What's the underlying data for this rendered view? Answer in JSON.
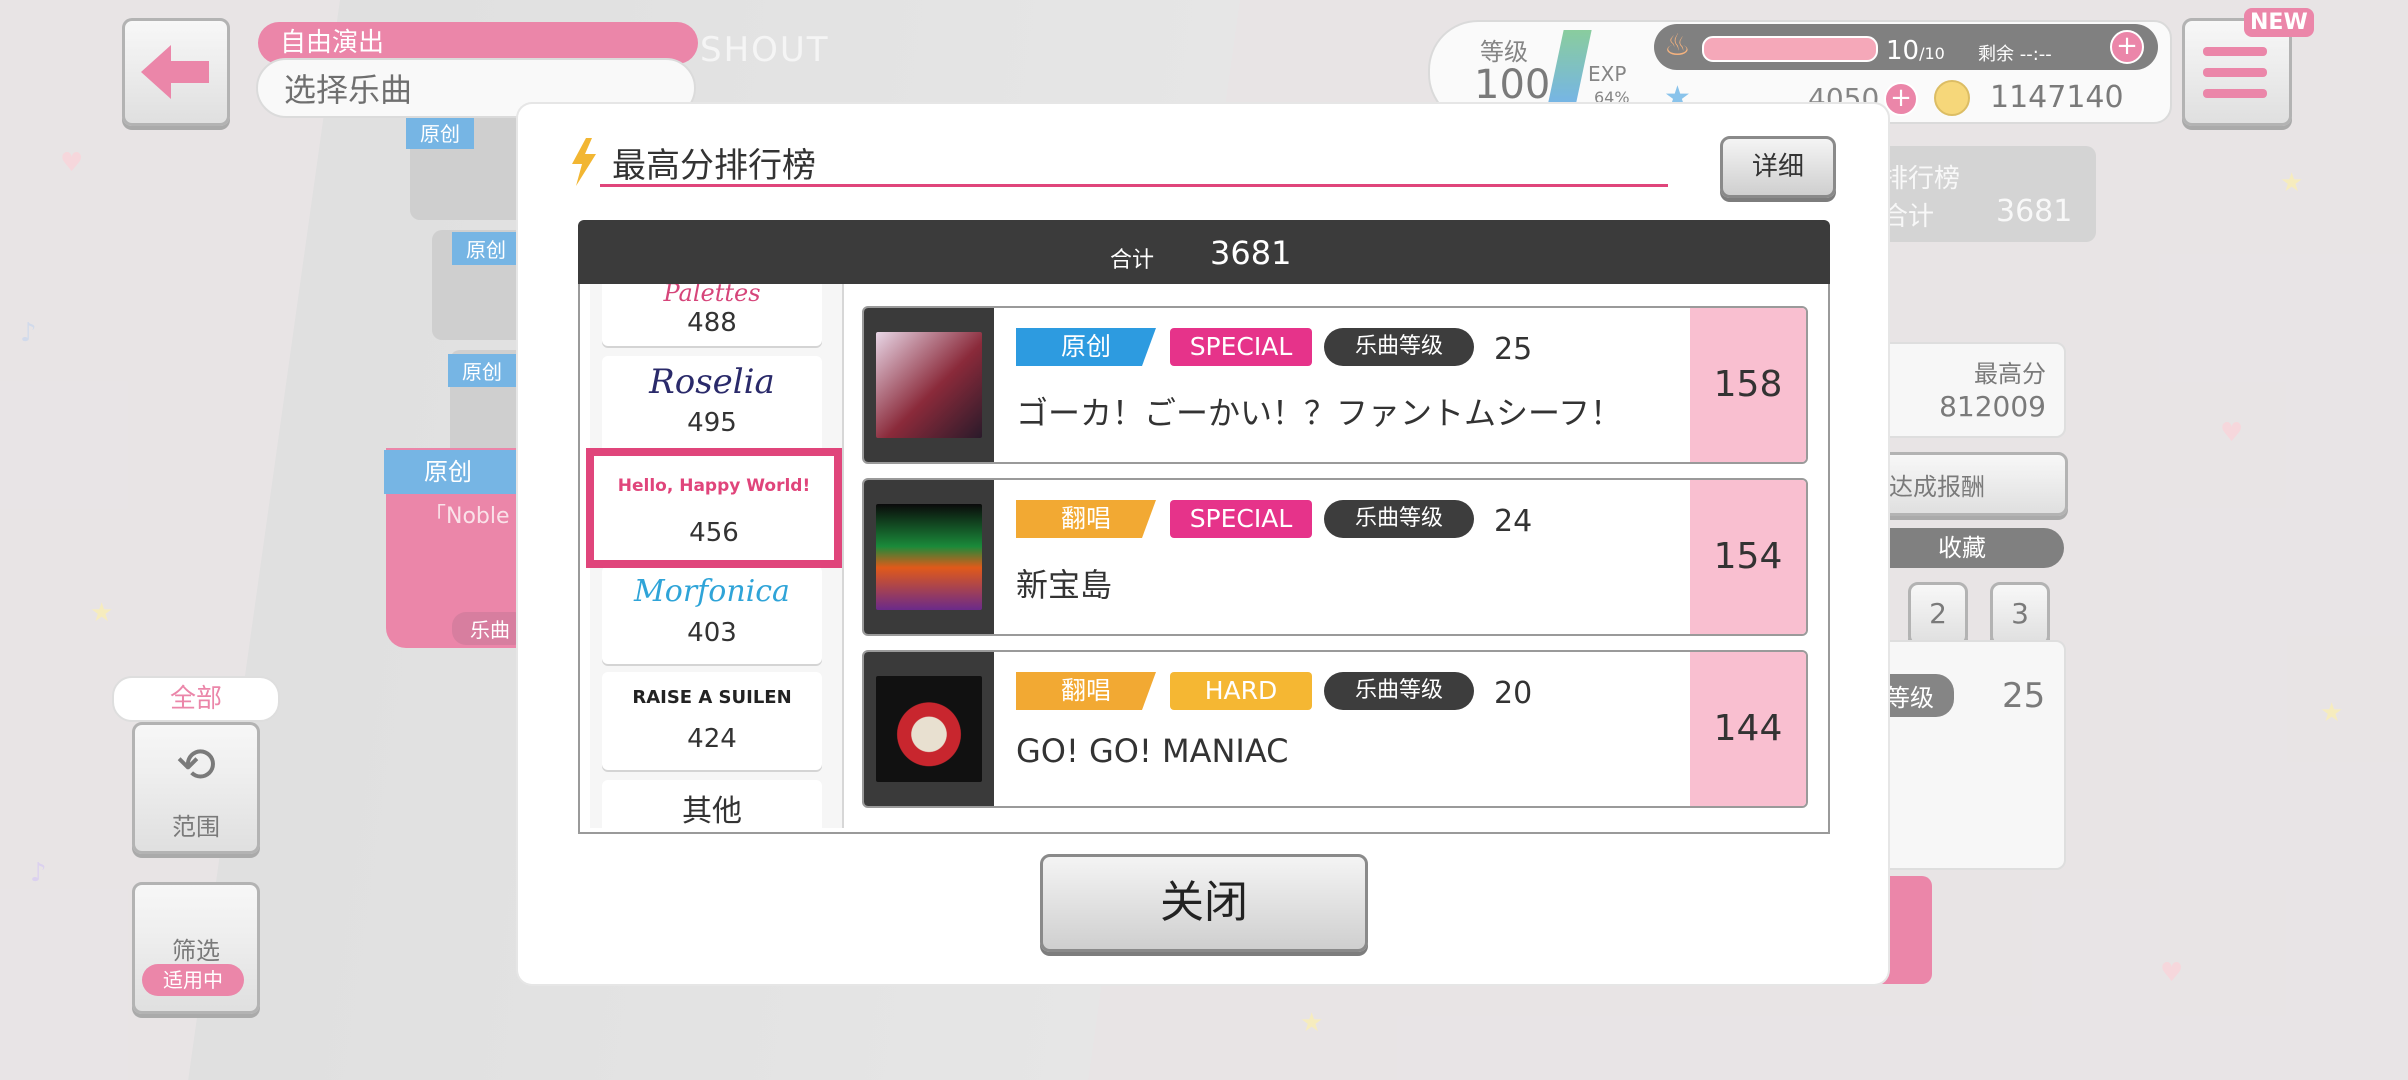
{
  "background": {
    "mode_label": "自由演出",
    "mode_title": "选择乐曲",
    "shout_text": "SHOUT",
    "level_label": "等级",
    "level_value": "100",
    "exp_label": "EXP",
    "exp_percent": "64%",
    "stamina_text": "10",
    "stamina_max": "/10",
    "remain_text": "剩余 --:--",
    "star_value": "4050",
    "coin_value": "1147140",
    "new_badge": "NEW",
    "rank_label": "排行榜",
    "rank_total_label": "合计",
    "rank_total_value": "3681",
    "best_label": "最高分",
    "best_value": "812009",
    "reward_label": "达成报酬",
    "favorite_label": "收藏",
    "fav_pages": [
      "2",
      "3"
    ],
    "difficulty_label": "等级",
    "difficulty_value": "25",
    "scope_header": "全部",
    "scope_label": "范围",
    "filter_label": "筛选",
    "filter_active": "适用中",
    "song_cards": [
      "原创",
      "原创",
      "原创"
    ],
    "noble_tag": "原创",
    "noble_text": "「Noble ...",
    "noble_sub": "乐曲"
  },
  "modal": {
    "title": "最高分排行榜",
    "detail_button": "详细",
    "total_label": "合计",
    "total_value": "3681",
    "close_button": "关闭",
    "bands": [
      {
        "logo": "Palettes",
        "score": "488",
        "color": "#d6457a"
      },
      {
        "logo": "Roselia",
        "score": "495",
        "color": "#2a2a6a"
      },
      {
        "logo": "Hello, Happy World!",
        "score": "456",
        "color": "#e0457b"
      },
      {
        "logo": "Morfonica",
        "score": "403",
        "color": "#2fa4d8"
      },
      {
        "logo": "RAISE A SUILEN",
        "score": "424",
        "color": "#222222"
      },
      {
        "logo": "其他",
        "score": "",
        "color": "#333333"
      }
    ],
    "selected_band": "Hello, Happy World!",
    "songs": [
      {
        "type": "原创",
        "type_color": "#2d9be0",
        "difficulty": "SPECIAL",
        "difficulty_color": "#e6338a",
        "level_label": "乐曲等级",
        "level": "25",
        "name": "ゴーカ！ごーかい！？ファントムシーフ！",
        "score": "158",
        "jacket_color": "#8a2a3a"
      },
      {
        "type": "翻唱",
        "type_color": "#f2a933",
        "difficulty": "SPECIAL",
        "difficulty_color": "#e6338a",
        "level_label": "乐曲等级",
        "level": "24",
        "name": "新宝島",
        "score": "154",
        "jacket_color": "#1a8a3a"
      },
      {
        "type": "翻唱",
        "type_color": "#f2a933",
        "difficulty": "HARD",
        "difficulty_color": "#f5b733",
        "level_label": "乐曲等级",
        "level": "20",
        "name": "GO! GO! MANIAC",
        "score": "144",
        "jacket_color": "#c8262e"
      }
    ]
  }
}
